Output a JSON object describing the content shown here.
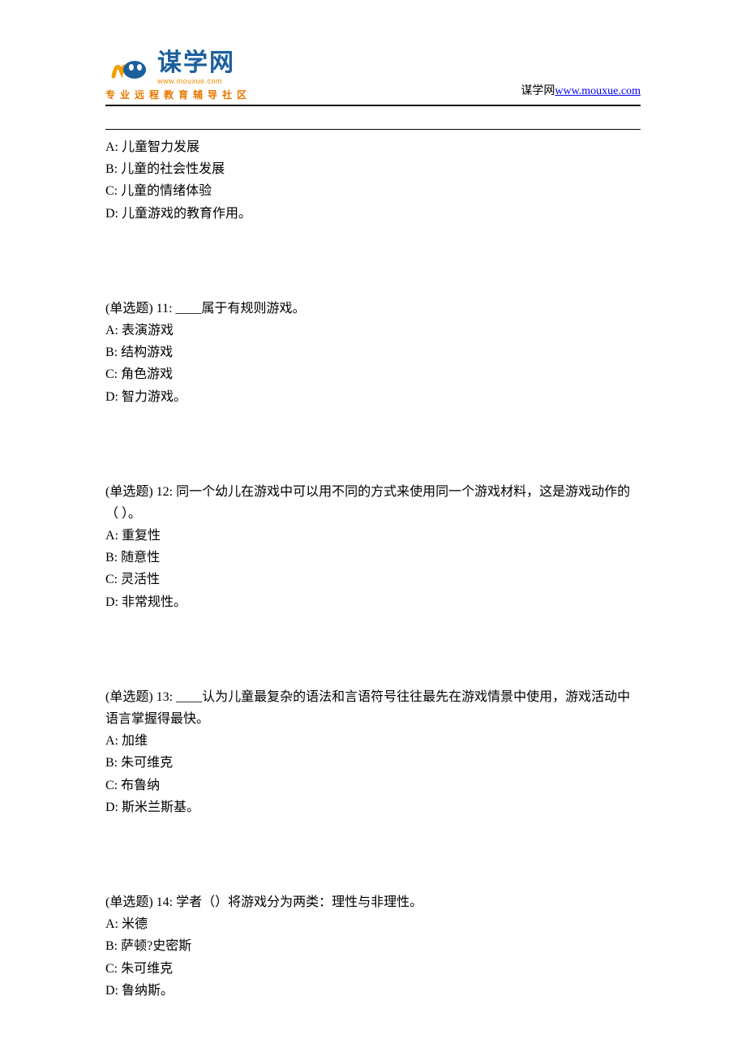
{
  "header": {
    "logo_main": "谋学网",
    "logo_domain": "www.mouxue.com",
    "logo_tagline": "专业远程教育辅导社区",
    "site_label": "谋学网",
    "site_url": "www.mouxue.com"
  },
  "prev_question": {
    "options": {
      "A": "A: 儿童智力发展",
      "B": "B: 儿童的社会性发展",
      "C": "C: 儿童的情绪体验",
      "D": "D: 儿童游戏的教育作用。"
    }
  },
  "questions": [
    {
      "prompt": "(单选题) 11: ____属于有规则游戏。",
      "options": {
        "A": "A: 表演游戏",
        "B": "B: 结构游戏",
        "C": "C: 角色游戏",
        "D": "D: 智力游戏。"
      }
    },
    {
      "prompt": "(单选题) 12: 同一个幼儿在游戏中可以用不同的方式来使用同一个游戏材料，这是游戏动作的（ ）。",
      "options": {
        "A": "A: 重复性",
        "B": "B: 随意性",
        "C": "C: 灵活性",
        "D": "D: 非常规性。"
      }
    },
    {
      "prompt": "(单选题) 13: ____认为儿童最复杂的语法和言语符号往往最先在游戏情景中使用，游戏活动中语言掌握得最快。",
      "options": {
        "A": "A: 加维",
        "B": "B: 朱可维克",
        "C": "C: 布鲁纳",
        "D": "D: 斯米兰斯基。"
      }
    },
    {
      "prompt": "(单选题) 14: 学者（）将游戏分为两类：理性与非理性。",
      "options": {
        "A": "A: 米德",
        "B": "B: 萨顿?史密斯",
        "C": "C: 朱可维克",
        "D": "D: 鲁纳斯。"
      }
    }
  ]
}
